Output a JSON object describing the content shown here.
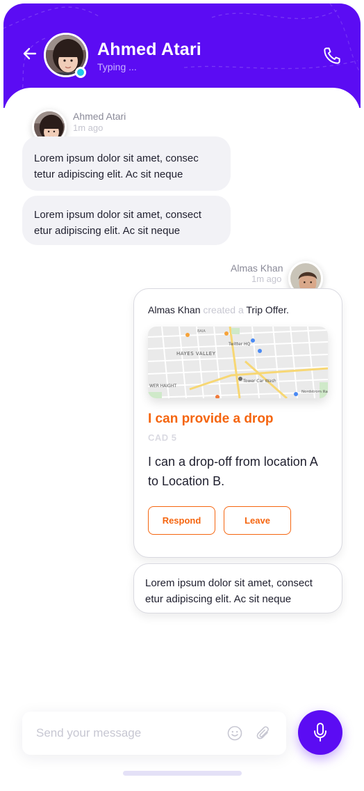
{
  "header": {
    "contact_name": "Ahmed Atari",
    "status": "Typing ...",
    "online_color": "#22c6ea",
    "brand_color": "#5b0cf3",
    "back_icon": "arrow-left-icon",
    "call_icon": "phone-icon"
  },
  "incoming": {
    "sender": "Ahmed Atari",
    "time": "1m ago",
    "messages": [
      "Lorem ipsum dolor sit amet, consec tetur adipiscing elit. Ac sit neque",
      "Lorem ipsum dolor sit amet, consect etur adipiscing elit. Ac sit neque"
    ]
  },
  "outgoing": {
    "sender": "Almas Khan",
    "time": "1m ago",
    "offer": {
      "actor": "Almas Khan",
      "verb": "created a",
      "object": "Trip Offer.",
      "map_labels": [
        "HAYES VALLEY",
        "Twitter HQ",
        "Tower Car Wash",
        "WER HAIGHT",
        "Nordstrom Ra",
        "BAIA"
      ],
      "title": "I can provide a drop",
      "price": "CAD 5",
      "description": "I can a drop-off from location A to Location B.",
      "respond_label": "Respond",
      "leave_label": "Leave",
      "accent_color": "#f5650f"
    },
    "message": "Lorem ipsum dolor sit amet, consect etur adipiscing elit. Ac sit neque"
  },
  "composer": {
    "placeholder": "Send your message",
    "emoji_icon": "smiley-icon",
    "attach_icon": "paperclip-icon",
    "mic_icon": "microphone-icon"
  }
}
